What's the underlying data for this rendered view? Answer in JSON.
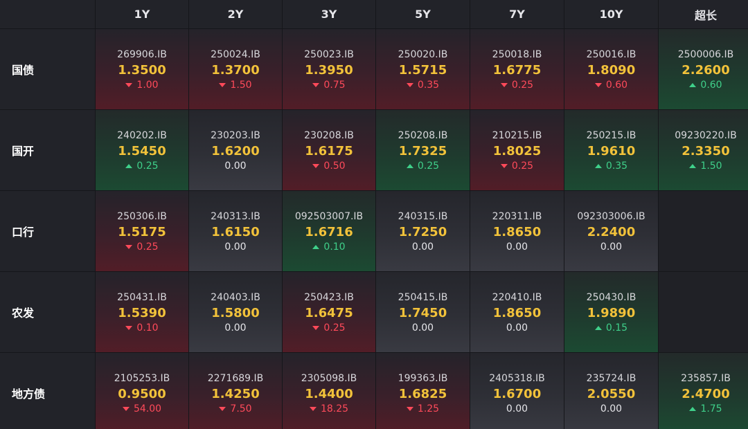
{
  "columns": [
    "1Y",
    "2Y",
    "3Y",
    "5Y",
    "7Y",
    "10Y",
    "超长"
  ],
  "colors": {
    "yield": "#f2c23a",
    "down": "#ff4a5a",
    "up": "#3fd08a"
  },
  "rows": [
    {
      "name": "国债",
      "cells": [
        {
          "code": "269906.IB",
          "yield": "1.3500",
          "change": "1.00",
          "direction": "down"
        },
        {
          "code": "250024.IB",
          "yield": "1.3700",
          "change": "1.50",
          "direction": "down"
        },
        {
          "code": "250023.IB",
          "yield": "1.3950",
          "change": "0.75",
          "direction": "down"
        },
        {
          "code": "250020.IB",
          "yield": "1.5715",
          "change": "0.35",
          "direction": "down"
        },
        {
          "code": "250018.IB",
          "yield": "1.6775",
          "change": "0.25",
          "direction": "down"
        },
        {
          "code": "250016.IB",
          "yield": "1.8090",
          "change": "0.60",
          "direction": "down"
        },
        {
          "code": "2500006.IB",
          "yield": "2.2600",
          "change": "0.60",
          "direction": "up"
        }
      ]
    },
    {
      "name": "国开",
      "cells": [
        {
          "code": "240202.IB",
          "yield": "1.5450",
          "change": "0.25",
          "direction": "up"
        },
        {
          "code": "230203.IB",
          "yield": "1.6200",
          "change": "0.00",
          "direction": "flat"
        },
        {
          "code": "230208.IB",
          "yield": "1.6175",
          "change": "0.50",
          "direction": "down"
        },
        {
          "code": "250208.IB",
          "yield": "1.7325",
          "change": "0.25",
          "direction": "up"
        },
        {
          "code": "210215.IB",
          "yield": "1.8025",
          "change": "0.25",
          "direction": "down"
        },
        {
          "code": "250215.IB",
          "yield": "1.9610",
          "change": "0.35",
          "direction": "up"
        },
        {
          "code": "09230220.IB",
          "yield": "2.3350",
          "change": "1.50",
          "direction": "up"
        }
      ]
    },
    {
      "name": "口行",
      "cells": [
        {
          "code": "250306.IB",
          "yield": "1.5175",
          "change": "0.25",
          "direction": "down"
        },
        {
          "code": "240313.IB",
          "yield": "1.6150",
          "change": "0.00",
          "direction": "flat"
        },
        {
          "code": "092503007.IB",
          "yield": "1.6716",
          "change": "0.10",
          "direction": "up"
        },
        {
          "code": "240315.IB",
          "yield": "1.7250",
          "change": "0.00",
          "direction": "flat"
        },
        {
          "code": "220311.IB",
          "yield": "1.8650",
          "change": "0.00",
          "direction": "flat"
        },
        {
          "code": "092303006.IB",
          "yield": "2.2400",
          "change": "0.00",
          "direction": "flat"
        },
        null
      ]
    },
    {
      "name": "农发",
      "cells": [
        {
          "code": "250431.IB",
          "yield": "1.5390",
          "change": "0.10",
          "direction": "down"
        },
        {
          "code": "240403.IB",
          "yield": "1.5800",
          "change": "0.00",
          "direction": "flat"
        },
        {
          "code": "250423.IB",
          "yield": "1.6475",
          "change": "0.25",
          "direction": "down"
        },
        {
          "code": "250415.IB",
          "yield": "1.7450",
          "change": "0.00",
          "direction": "flat"
        },
        {
          "code": "220410.IB",
          "yield": "1.8650",
          "change": "0.00",
          "direction": "flat"
        },
        {
          "code": "250430.IB",
          "yield": "1.9890",
          "change": "0.15",
          "direction": "up"
        },
        null
      ]
    },
    {
      "name": "地方债",
      "cells": [
        {
          "code": "2105253.IB",
          "yield": "0.9500",
          "change": "54.00",
          "direction": "down"
        },
        {
          "code": "2271689.IB",
          "yield": "1.4250",
          "change": "7.50",
          "direction": "down"
        },
        {
          "code": "2305098.IB",
          "yield": "1.4400",
          "change": "18.25",
          "direction": "down"
        },
        {
          "code": "199363.IB",
          "yield": "1.6825",
          "change": "1.25",
          "direction": "down"
        },
        {
          "code": "2405318.IB",
          "yield": "1.6700",
          "change": "0.00",
          "direction": "flat"
        },
        {
          "code": "235724.IB",
          "yield": "2.0550",
          "change": "0.00",
          "direction": "flat"
        },
        {
          "code": "235857.IB",
          "yield": "2.4700",
          "change": "1.75",
          "direction": "up"
        }
      ]
    }
  ]
}
